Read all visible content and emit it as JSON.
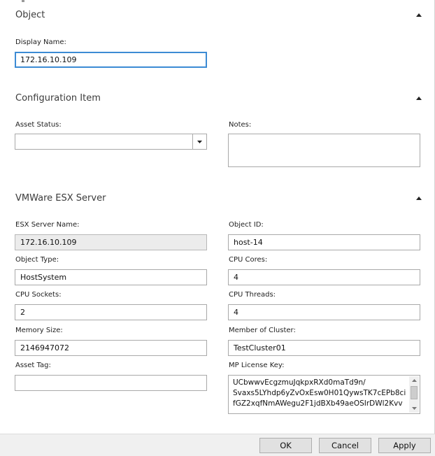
{
  "sections": {
    "object": {
      "title": "Object"
    },
    "config": {
      "title": "Configuration Item"
    },
    "vmware": {
      "title": "VMWare ESX Server"
    }
  },
  "object": {
    "display_name_label": "Display Name:",
    "display_name_value": "172.16.10.109"
  },
  "config": {
    "asset_status_label": "Asset Status:",
    "asset_status_value": "",
    "notes_label": "Notes:",
    "notes_value": ""
  },
  "vmware": {
    "esx_server_name_label": "ESX Server Name:",
    "esx_server_name_value": "172.16.10.109",
    "object_id_label": "Object ID:",
    "object_id_value": "host-14",
    "object_type_label": "Object Type:",
    "object_type_value": "HostSystem",
    "cpu_cores_label": "CPU Cores:",
    "cpu_cores_value": "4",
    "cpu_sockets_label": "CPU Sockets:",
    "cpu_sockets_value": "2",
    "cpu_threads_label": "CPU Threads:",
    "cpu_threads_value": "4",
    "memory_size_label": "Memory Size:",
    "memory_size_value": "2146947072",
    "member_of_cluster_label": "Member of Cluster:",
    "member_of_cluster_value": "TestCluster01",
    "asset_tag_label": "Asset Tag:",
    "asset_tag_value": "",
    "mp_license_key_label": "MP License Key:",
    "mp_license_key_lines": [
      "UCbwwvEcgzmuJqkpxRXd0maTd9n/",
      "Svaxs5LYhdp6yZvOxEsw0H01QywsTK7cEPb8ci",
      "fGZ2xqfNmAWegu2F1jdBXb49aeOSIrDWl2Kvv"
    ]
  },
  "footer": {
    "ok_label": "OK",
    "cancel_label": "Cancel",
    "apply_label": "Apply"
  },
  "icons": {
    "collapse": "chevron-up-icon",
    "dropdown": "chevron-down-icon"
  }
}
